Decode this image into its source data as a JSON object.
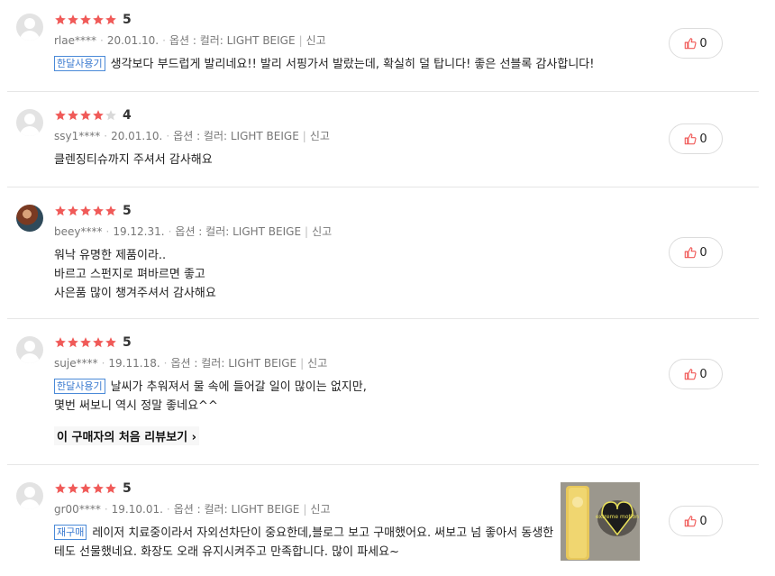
{
  "colors": {
    "star_on": "#f05a58",
    "star_off": "#d9d9d9",
    "tag_blue": "#3a7ad0",
    "like_icon": "#f05a58"
  },
  "reviews": [
    {
      "rating": 5,
      "score_label": "5",
      "user": "rlae****",
      "date": "20.01.10.",
      "option": "옵션 : 컬러: LIGHT BEIGE",
      "report": "신고",
      "tag": "한달사용기",
      "lines": [
        "생각보다 부드럽게 발리네요!! 발리 서핑가서 발랐는데, 확실히 덜 탑니다! 좋은 선블록 감사합니다!"
      ],
      "likes": "0"
    },
    {
      "rating": 4,
      "score_label": "4",
      "user": "ssy1****",
      "date": "20.01.10.",
      "option": "옵션 : 컬러: LIGHT BEIGE",
      "report": "신고",
      "tag": "",
      "lines": [
        "클렌징티슈까지 주셔서 감사해요"
      ],
      "likes": "0"
    },
    {
      "rating": 5,
      "score_label": "5",
      "user": "beey****",
      "date": "19.12.31.",
      "option": "옵션 : 컬러: LIGHT BEIGE",
      "report": "신고",
      "tag": "",
      "lines": [
        "워낙 유명한 제품이라..",
        "바르고 스펀지로 펴바르면 좋고",
        "사은품 많이 챙겨주셔서 감사해요"
      ],
      "likes": "0"
    },
    {
      "rating": 5,
      "score_label": "5",
      "user": "suje****",
      "date": "19.11.18.",
      "option": "옵션 : 컬러: LIGHT BEIGE",
      "report": "신고",
      "tag": "한달사용기",
      "lines": [
        "날씨가 추워져서 물 속에 들어갈 일이 많이는 없지만,",
        "몇번 써보니 역시 정말 좋네요^^"
      ],
      "first_review_link": "이 구매자의 처음 리뷰보기",
      "likes": "0"
    },
    {
      "rating": 5,
      "score_label": "5",
      "user": "gr00****",
      "date": "19.10.01.",
      "option": "옵션 : 컬러: LIGHT BEIGE",
      "report": "신고",
      "tag": "재구매",
      "lines": [
        "레이저 치료중이라서 자외선차단이 중요한데,블로그 보고 구매했어요. 써보고 넘 좋아서 동생한",
        "테도 선물했네요. 화장도 오래 유지시켜주고 만족합니다. 많이 파세요~"
      ],
      "photo_label": "extreme motion",
      "likes": "0"
    }
  ]
}
